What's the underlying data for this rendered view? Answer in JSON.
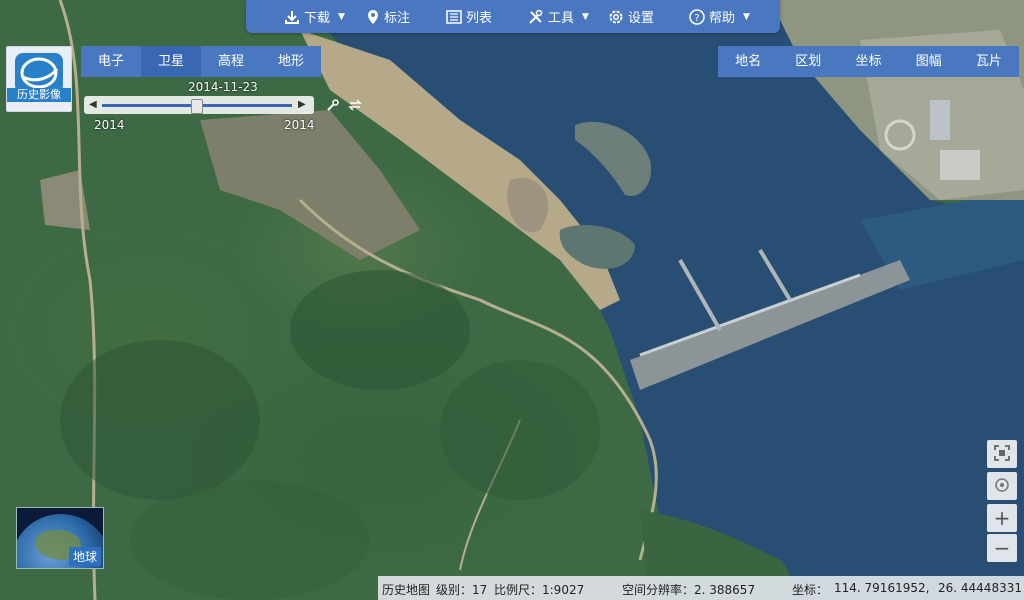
{
  "toolbar": {
    "download": "下载",
    "mark": "标注",
    "list": "列表",
    "tools": "工具",
    "settings": "设置",
    "help": "帮助"
  },
  "logo": {
    "label": "历史影像"
  },
  "map_type_tabs": [
    {
      "label": "电子",
      "active": false
    },
    {
      "label": "卫星",
      "active": true
    },
    {
      "label": "高程",
      "active": false
    },
    {
      "label": "地形",
      "active": false
    }
  ],
  "right_tabs": [
    {
      "label": "地名"
    },
    {
      "label": "区划"
    },
    {
      "label": "坐标"
    },
    {
      "label": "图幅"
    },
    {
      "label": "瓦片"
    }
  ],
  "timeline": {
    "date": "2014-11-23",
    "start_year": "2014",
    "end_year": "2014",
    "position": 0.5
  },
  "earth": {
    "label": "地球"
  },
  "status": {
    "source": "历史地图",
    "level": "级别：17",
    "scale": "比例尺：1:9027",
    "resolution": "空间分辨率：2. 388657",
    "coords_label": "坐标：",
    "lon": "114. 79161952,",
    "lat": "26. 44448331"
  },
  "colors": {
    "toolbar_bg": "#4a78c0",
    "active_tab": "#3a67b3",
    "water": "#284f73",
    "vegetation": "#3d6a44"
  }
}
